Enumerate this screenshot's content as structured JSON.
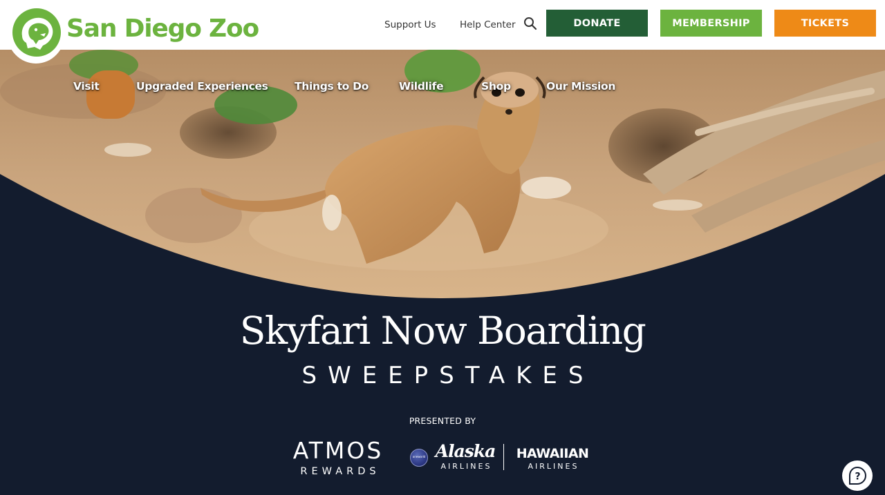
{
  "brand": {
    "name": "San Diego Zoo",
    "color": "#6cb33f"
  },
  "utility_nav": {
    "support": "Support Us",
    "help": "Help Center",
    "search_icon": "search-icon"
  },
  "cta_buttons": {
    "donate": {
      "label": "DONATE",
      "color": "#235e36"
    },
    "membership": {
      "label": "MEMBERSHIP",
      "color": "#6cb33f"
    },
    "tickets": {
      "label": "TICKETS",
      "color": "#ee8a17"
    }
  },
  "main_nav": [
    "Visit",
    "Upgraded Experiences",
    "Things to Do",
    "Wildlife",
    "Shop",
    "Our Mission"
  ],
  "hero": {
    "subject": "meerkat-photo",
    "background_color": "#131c2e"
  },
  "promo": {
    "headline": "Skyfari Now Boarding",
    "subline": "SWEEPSTAKES",
    "presented_by": "PRESENTED BY"
  },
  "sponsors": {
    "atmos": "ATMOS",
    "atmos_sub": "REWARDS",
    "oneworld": "oneworld",
    "alaska": "Alaska",
    "alaska_sub": "AIRLINES",
    "hawaiian": "HAWAIIAN",
    "hawaiian_sub": "AIRLINES"
  },
  "help_widget": {
    "icon": "question-mark-icon"
  }
}
